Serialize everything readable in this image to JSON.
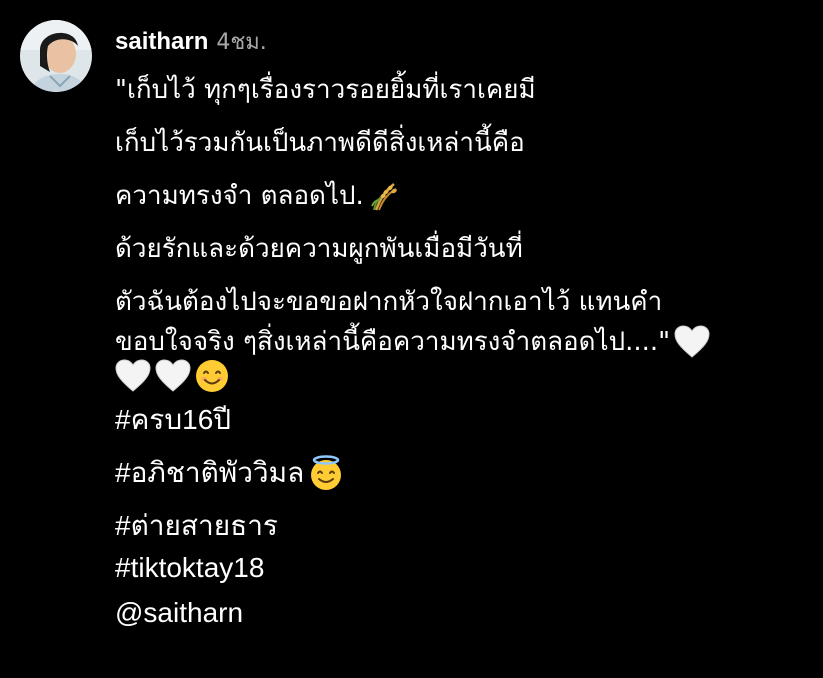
{
  "comment": {
    "username": "saitharn",
    "timestamp": "4ชม.",
    "caption_lines": [
      "\"เก็บไว้ ทุกๆเรื่องราวรอยยิ้มที่เราเคยมี",
      "เก็บไว้รวมกันเป็นภาพดีดีสิ่งเหล่านี้คือ",
      "ความทรงจำ ตลอดไป.",
      "ด้วยรักและด้วยความผูกพันเมื่อมีวันที่",
      "ตัวฉันต้องไปจะขอขอฝากหัวใจฝากเอาไว้ แทนคำ",
      "ขอบใจจริง ๆสิ่งเหล่านี้คือความทรงจำตลอดไป....\""
    ],
    "hashtags": [
      "#ครบ16ปี",
      "#อภิชาติพัววิมล",
      "#ต่ายสายธาร",
      "#tiktoktay18"
    ],
    "mention": "@saitharn",
    "emojis": {
      "rice": "rice-sheaf-icon",
      "white_heart": "white-heart-icon",
      "smile": "smiling-face-icon",
      "halo": "smiling-face-with-halo-icon"
    }
  },
  "colors": {
    "background": "#000000",
    "text": "#ffffff",
    "muted": "#a8a8a8"
  }
}
